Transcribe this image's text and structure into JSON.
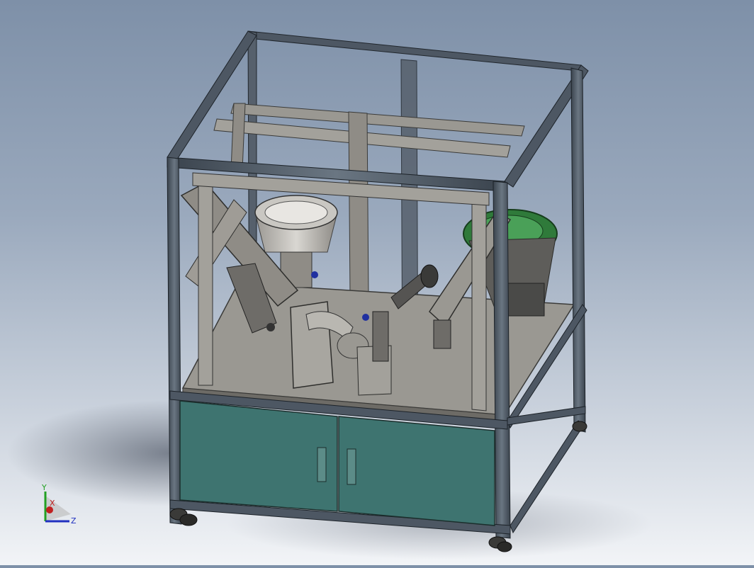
{
  "viewport": {
    "background_top": "#7e90a8",
    "background_bottom": "#f2f4f7"
  },
  "model": {
    "frame_color": "#4d5763",
    "plate_color": "#9a9892",
    "cabinet_color": "#3e7470",
    "bowl_color": "#2f7a3a",
    "part_color": "#8f8c86"
  },
  "triad": {
    "y_label": "Y",
    "x_label": "X",
    "z_label": "Z",
    "y_color": "#22a022",
    "x_color": "#c02020",
    "z_color": "#2030c0"
  }
}
